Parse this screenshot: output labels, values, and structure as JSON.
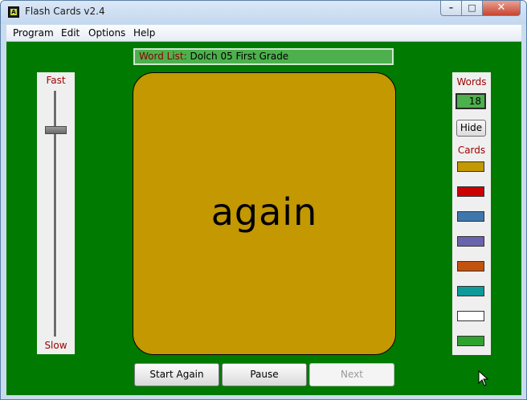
{
  "window": {
    "title": "Flash Cards v2.4",
    "app_icon_letter": "A"
  },
  "controls": {
    "minimize": "–",
    "maximize": "□",
    "close": "✕"
  },
  "menu": [
    {
      "label": "Program"
    },
    {
      "label": "Edit"
    },
    {
      "label": "Options"
    },
    {
      "label": "Help"
    }
  ],
  "word_list": {
    "label": "Word List:",
    "value": "Dolch 05 First Grade"
  },
  "speed": {
    "top_label": "Fast",
    "bottom_label": "Slow",
    "level": 0.85
  },
  "card": {
    "word": "again",
    "color": "#c39800"
  },
  "words_panel": {
    "words_label": "Words",
    "count": "18",
    "hide_label": "Hide",
    "cards_label": "Cards",
    "card_colors": [
      {
        "name": "gold-card-swatch",
        "color": "#c39800"
      },
      {
        "name": "red-card-swatch",
        "color": "#cc0000"
      },
      {
        "name": "steel-blue-card-swatch",
        "color": "#3f77ad"
      },
      {
        "name": "purple-card-swatch",
        "color": "#6a63ad"
      },
      {
        "name": "orange-card-swatch",
        "color": "#c4520f"
      },
      {
        "name": "teal-card-swatch",
        "color": "#0f9a9a"
      },
      {
        "name": "white-card-swatch",
        "color": "#ffffff"
      },
      {
        "name": "green-card-swatch",
        "color": "#2ea22e"
      }
    ]
  },
  "buttons": {
    "start_again": "Start Again",
    "pause": "Pause",
    "next": "Next"
  },
  "colors": {
    "background": "#007a00",
    "label_red": "#9b0000"
  }
}
